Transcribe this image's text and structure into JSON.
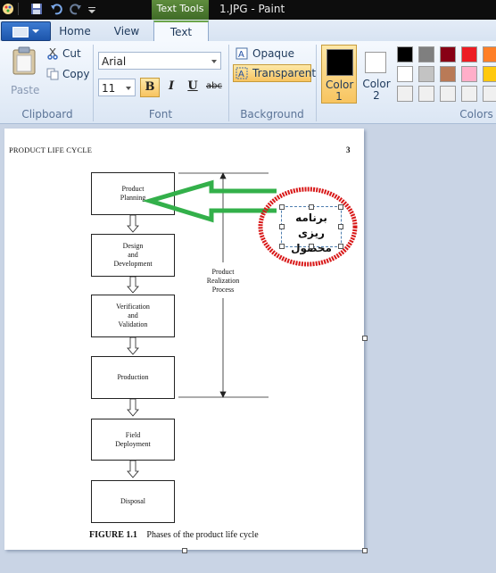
{
  "titlebar": {
    "quick_access_icons": [
      "paint-app-icon",
      "save-icon",
      "undo-icon",
      "redo-icon",
      "customize-arrow-icon"
    ],
    "context_tab": "Text Tools",
    "window_title": "1.JPG - Paint"
  },
  "tabs": {
    "home": "Home",
    "view": "View",
    "text": "Text"
  },
  "ribbon": {
    "clipboard": {
      "paste": "Paste",
      "cut": "Cut",
      "copy": "Copy",
      "label": "Clipboard"
    },
    "font": {
      "family": "Arial",
      "size": "11",
      "bold": "B",
      "italic": "I",
      "underline": "U",
      "strikethrough": "abc",
      "label": "Font"
    },
    "background": {
      "opaque": "Opaque",
      "transparent": "Transparent",
      "label": "Background"
    },
    "colors": {
      "color1": "Color",
      "color1_num": "1",
      "color2": "Color",
      "color2_num": "2",
      "label": "Colors",
      "color1_value": "#000000",
      "color2_value": "#ffffff",
      "palette_row1": [
        "#000000",
        "#7f7f7f",
        "#880015",
        "#ed1c24",
        "#ff7f27"
      ],
      "palette_row2": [
        "#ffffff",
        "#c3c3c3",
        "#b97a57",
        "#ffaec9",
        "#ffc90e"
      ],
      "palette_row3": [
        "#f0f0f0",
        "#f0f0f0",
        "#f0f0f0",
        "#f0f0f0",
        "#f0f0f0"
      ]
    }
  },
  "document": {
    "header_left": "PRODUCT LIFE CYCLE",
    "header_page": "3",
    "stages": [
      {
        "l1": "Product",
        "l2": "Planning",
        "l3": ""
      },
      {
        "l1": "Design",
        "l2": "and",
        "l3": "Development"
      },
      {
        "l1": "Verification",
        "l2": "and",
        "l3": "Validation"
      },
      {
        "l1": "Production",
        "l2": "",
        "l3": ""
      },
      {
        "l1": "Field",
        "l2": "Deployment",
        "l3": ""
      },
      {
        "l1": "Disposal",
        "l2": "",
        "l3": ""
      }
    ],
    "process_label": [
      "Product",
      "Realization",
      "Process"
    ],
    "figure_label": "FIGURE 1.1",
    "figure_caption": "Phases of the product life cycle",
    "annotation_line1": "برنامه ریزی",
    "annotation_line2": "محصول",
    "arrow_color": "#2ea44f",
    "circle_color": "#d81818"
  }
}
